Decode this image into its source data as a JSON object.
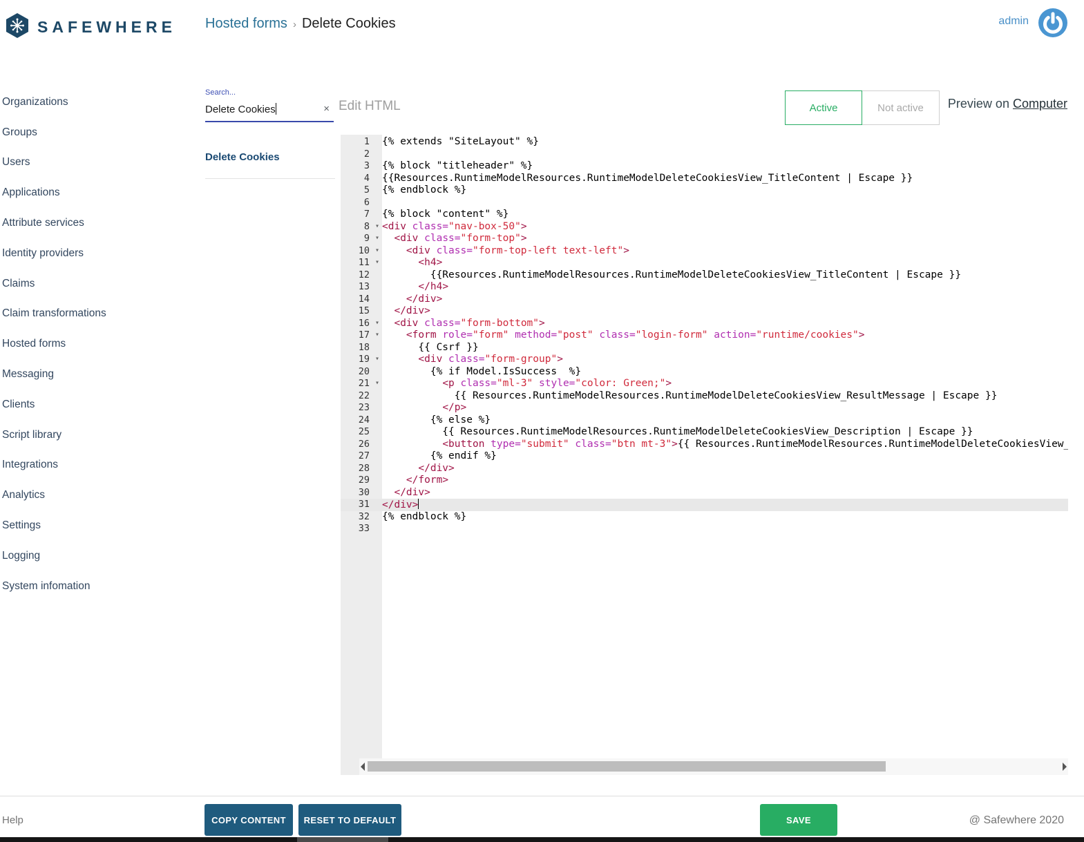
{
  "colors": {
    "navy": "#1d4866",
    "green": "#28ad63",
    "steel": "#1f5b7e",
    "accent_indigo": "#3949ab",
    "link_blue": "#2a7196",
    "tag": "#a01446",
    "attr": "#b02eb0",
    "str": "#d02a3c"
  },
  "header": {
    "brand": "SAFEWHERE",
    "breadcrumb": {
      "section": "Hosted forms",
      "separator": "›",
      "current": "Delete Cookies"
    },
    "user": "admin"
  },
  "sidebar": {
    "items": [
      "Organizations",
      "Groups",
      "Users",
      "Applications",
      "Attribute services",
      "Identity providers",
      "Claims",
      "Claim transformations",
      "Hosted forms",
      "Messaging",
      "Clients",
      "Script library",
      "Integrations",
      "Analytics",
      "Settings",
      "Logging",
      "System infomation"
    ]
  },
  "panel": {
    "search_label": "Search...",
    "search_value": "Delete Cookies",
    "clear_icon": "×",
    "results": [
      {
        "label": "Delete Cookies"
      }
    ]
  },
  "editor_header": {
    "title": "Edit HTML",
    "toggle": {
      "active_label": "Active",
      "inactive_label": "Not active",
      "selected": "Active"
    },
    "preview_prefix": "Preview on",
    "preview_link": "Computer"
  },
  "editor": {
    "active_line": 31,
    "fold_lines": [
      8,
      9,
      10,
      11,
      16,
      17,
      19,
      21
    ],
    "lines": [
      "{% extends \"SiteLayout\" %}",
      "",
      "{% block \"titleheader\" %}",
      "{{Resources.RuntimeModelResources.RuntimeModelDeleteCookiesView_TitleContent | Escape }}",
      "{% endblock %}",
      "",
      "{% block \"content\" %}",
      "<div class=\"nav-box-50\">",
      "  <div class=\"form-top\">",
      "    <div class=\"form-top-left text-left\">",
      "      <h4>",
      "        {{Resources.RuntimeModelResources.RuntimeModelDeleteCookiesView_TitleContent | Escape }}",
      "      </h4>",
      "    </div>",
      "  </div>",
      "  <div class=\"form-bottom\">",
      "    <form role=\"form\" method=\"post\" class=\"login-form\" action=\"runtime/cookies\">",
      "      {{ Csrf }}",
      "      <div class=\"form-group\">",
      "        {% if Model.IsSuccess  %}",
      "          <p class=\"ml-3\" style=\"color: Green;\">",
      "            {{ Resources.RuntimeModelResources.RuntimeModelDeleteCookiesView_ResultMessage | Escape }}",
      "          </p>",
      "        {% else %}",
      "          {{ Resources.RuntimeModelResources.RuntimeModelDeleteCookiesView_Description | Escape }}",
      "          <button type=\"submit\" class=\"btn mt-3\">{{ Resources.RuntimeModelResources.RuntimeModelDeleteCookiesView_",
      "        {% endif %}",
      "      </div>",
      "    </form>",
      "  </div>",
      "</div>",
      "{% endblock %}",
      ""
    ]
  },
  "footer": {
    "help": "Help",
    "copy_button": "COPY CONTENT",
    "reset_button": "RESET TO DEFAULT",
    "save_button": "SAVE",
    "copyright": "@ Safewhere 2020"
  }
}
